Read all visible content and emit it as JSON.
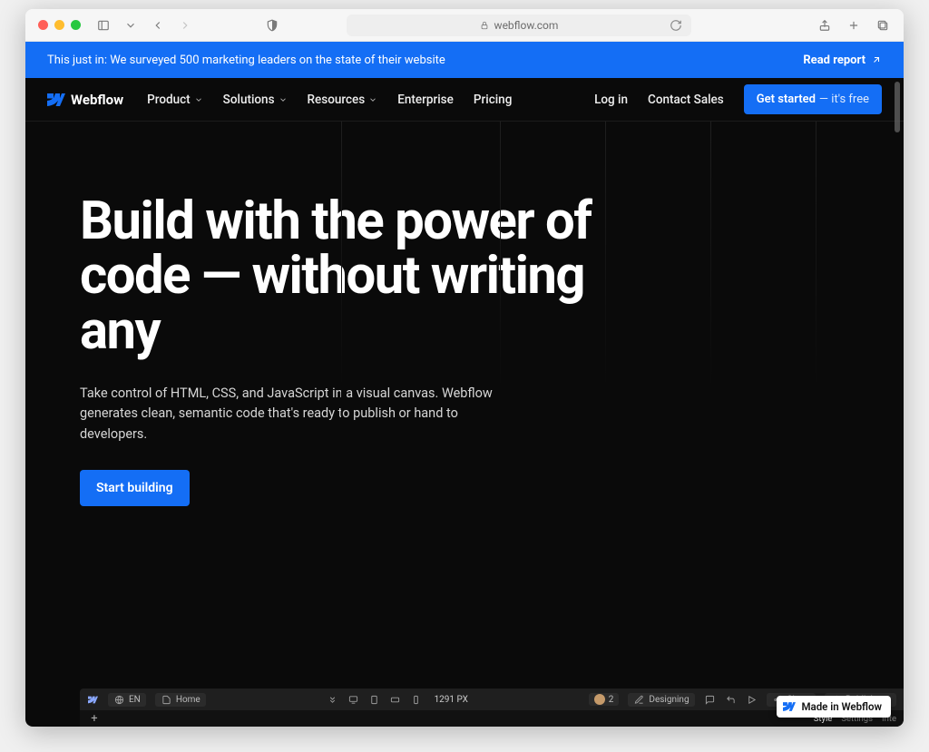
{
  "browser": {
    "url_host": "webflow.com"
  },
  "banner": {
    "text": "This just in: We surveyed 500 marketing leaders on the state of their website",
    "cta": "Read report"
  },
  "nav": {
    "brand": "Webflow",
    "items": [
      {
        "label": "Product",
        "dropdown": true
      },
      {
        "label": "Solutions",
        "dropdown": true
      },
      {
        "label": "Resources",
        "dropdown": true
      },
      {
        "label": "Enterprise",
        "dropdown": false
      },
      {
        "label": "Pricing",
        "dropdown": false
      }
    ],
    "login": "Log in",
    "contact": "Contact Sales",
    "cta_main": "Get started",
    "cta_sub": "— it's free"
  },
  "hero": {
    "title": "Build with the power of code — without writing any",
    "subtitle": "Take control of HTML, CSS, and JavaScript in a visual canvas. Webflow generates clean, semantic code that's ready to publish or hand to developers.",
    "cta": "Start building"
  },
  "designer": {
    "lang_chip": "EN",
    "page_chip": "Home",
    "width_readout": "1291 PX",
    "user_count": "2",
    "mode_chip": "Designing",
    "share": "Share",
    "publish": "Publish",
    "tabs": {
      "style": "Style",
      "settings": "Settings",
      "inter": "Inte"
    },
    "add": "+"
  },
  "badge": {
    "label": "Made in Webflow"
  },
  "colors": {
    "accent": "#146ef5",
    "bg_dark": "#0a0a0a"
  }
}
